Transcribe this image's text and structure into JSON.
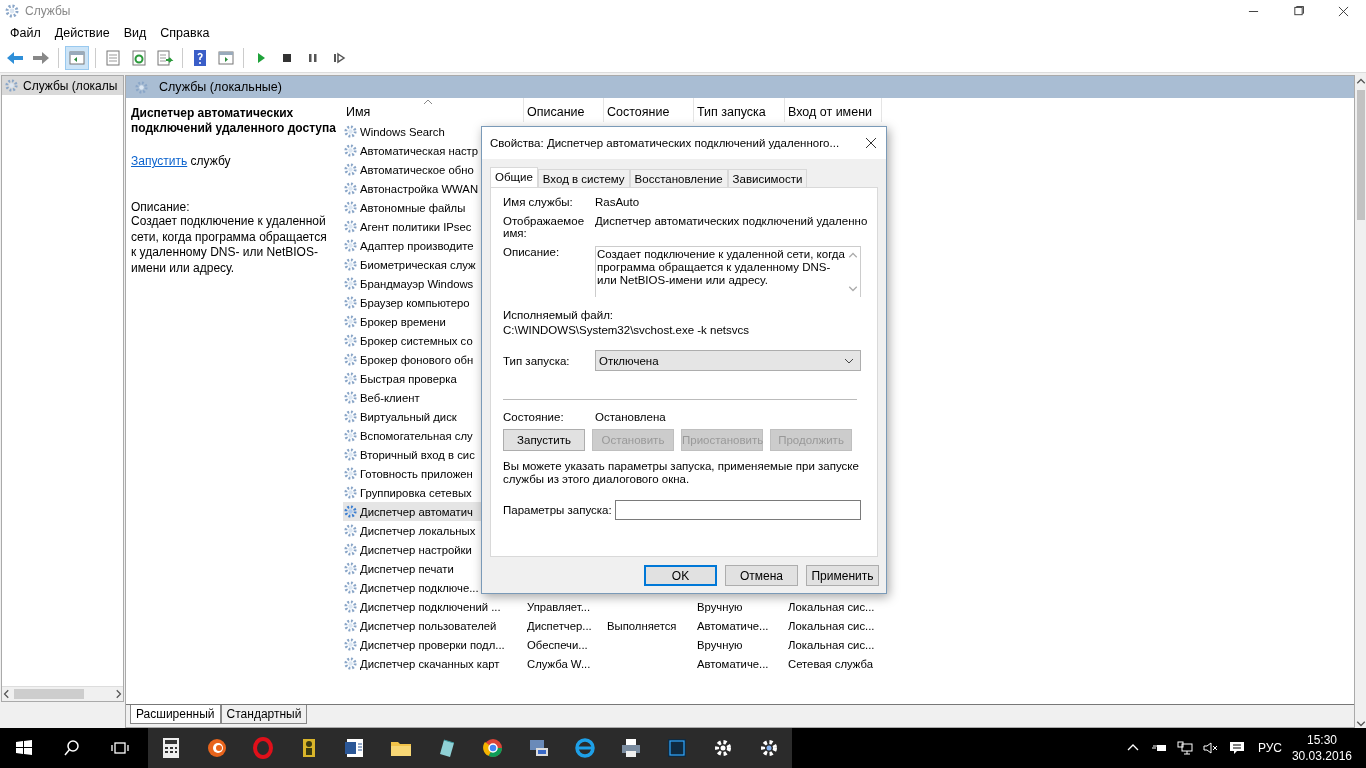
{
  "window": {
    "title": "Службы"
  },
  "menu": [
    "Файл",
    "Действие",
    "Вид",
    "Справка"
  ],
  "toolbar": {
    "console_tree_shown": true
  },
  "tree": {
    "items": [
      {
        "label": "Службы (локалы",
        "selected": true
      }
    ]
  },
  "panel": {
    "title": "Службы (локальные)"
  },
  "details": {
    "title": "Диспетчер автоматических подключений удаленного доступа",
    "action_link": "Запустить",
    "action_text": "службу",
    "description_label": "Описание:",
    "description": "Создает подключение к удаленной сети, когда программа обращается к удаленному DNS- или NetBIOS-имени или адресу."
  },
  "table": {
    "columns": [
      {
        "label": "Имя",
        "sorted": true
      },
      {
        "label": "Описание",
        "sorted": false
      },
      {
        "label": "Состояние",
        "sorted": false
      },
      {
        "label": "Тип запуска",
        "sorted": false
      },
      {
        "label": "Вход от имени",
        "sorted": false
      }
    ],
    "rows": [
      {
        "name": "Windows Search",
        "selected": false
      },
      {
        "name": "Автоматическая настр",
        "selected": false
      },
      {
        "name": "Автоматическое обно",
        "selected": false
      },
      {
        "name": "Автонастройка WWAN",
        "selected": false
      },
      {
        "name": "Автономные файлы",
        "selected": false
      },
      {
        "name": "Агент политики IPsec",
        "selected": false
      },
      {
        "name": "Адаптер производите",
        "selected": false
      },
      {
        "name": "Биометрическая служ",
        "selected": false
      },
      {
        "name": "Брандмауэр Windows",
        "selected": false
      },
      {
        "name": "Браузер компьютеро",
        "selected": false
      },
      {
        "name": "Брокер времени",
        "selected": false
      },
      {
        "name": "Брокер системных со",
        "selected": false
      },
      {
        "name": "Брокер фонового обн",
        "selected": false
      },
      {
        "name": "Быстрая проверка",
        "selected": false
      },
      {
        "name": "Веб-клиент",
        "selected": false
      },
      {
        "name": "Виртуальный диск",
        "selected": false
      },
      {
        "name": "Вспомогательная слу",
        "selected": false
      },
      {
        "name": "Вторичный вход в сис",
        "selected": false
      },
      {
        "name": "Готовность приложен",
        "selected": false
      },
      {
        "name": "Группировка сетевых",
        "selected": false
      },
      {
        "name": "Диспетчер автоматич",
        "selected": true
      },
      {
        "name": "Диспетчер локальных",
        "selected": false
      },
      {
        "name": "Диспетчер настройки",
        "selected": false
      },
      {
        "name": "Диспетчер печати",
        "selected": false
      },
      {
        "name": "Диспетчер подключе...",
        "selected": false
      },
      {
        "name": "Диспетчер подключений ...",
        "description": "Управляет...",
        "startup": "Вручную",
        "logon": "Локальная сис...",
        "selected": false
      },
      {
        "name": "Диспетчер пользователей",
        "description": "Диспетчер...",
        "status": "Выполняется",
        "startup": "Автоматиче...",
        "logon": "Локальная сис...",
        "selected": false
      },
      {
        "name": "Диспетчер проверки подл...",
        "description": "Обеспечи...",
        "startup": "Вручную",
        "logon": "Локальная сис...",
        "selected": false
      },
      {
        "name": "Диспетчер скачанных карт",
        "description": "Служба W...",
        "startup": "Автоматиче...",
        "logon": "Сетевая служба",
        "selected": false
      }
    ]
  },
  "view_tabs": [
    {
      "label": "Расширенный",
      "selected": true
    },
    {
      "label": "Стандартный",
      "selected": false
    }
  ],
  "dialog": {
    "title": "Свойства: Диспетчер автоматических подключений удаленного...",
    "tabs": [
      {
        "label": "Общие",
        "selected": true
      },
      {
        "label": "Вход в систему",
        "selected": false
      },
      {
        "label": "Восстановление",
        "selected": false
      },
      {
        "label": "Зависимости",
        "selected": false
      }
    ],
    "service_name_label": "Имя службы:",
    "service_name": "RasAuto",
    "display_name_label": "Отображаемое имя:",
    "display_name": "Диспетчер автоматических подключений удаленно",
    "description_label": "Описание:",
    "description": "Создает подключение к удаленной сети, когда программа обращается к удаленному DNS- или NetBIOS-имени или адресу.",
    "executable_label": "Исполняемый файл:",
    "executable_path": "C:\\WINDOWS\\System32\\svchost.exe -k netsvcs",
    "startup_type_label": "Тип запуска:",
    "startup_type": "Отключена",
    "status_label": "Состояние:",
    "status": "Остановлена",
    "control_buttons": [
      {
        "label": "Запустить",
        "disabled": false
      },
      {
        "label": "Остановить",
        "disabled": true
      },
      {
        "label": "Приостановить",
        "disabled": true
      },
      {
        "label": "Продолжить",
        "disabled": true
      }
    ],
    "hint": "Вы можете указать параметры запуска, применяемые при запуске службы из этого диалогового окна.",
    "params_label": "Параметры запуска:",
    "footer_buttons": [
      {
        "label": "OK",
        "default": true
      },
      {
        "label": "Отмена",
        "default": false
      },
      {
        "label": "Применить",
        "default": false
      }
    ]
  },
  "taskbar": {
    "language": "РУС",
    "time": "15:30",
    "date": "30.03.2016"
  }
}
